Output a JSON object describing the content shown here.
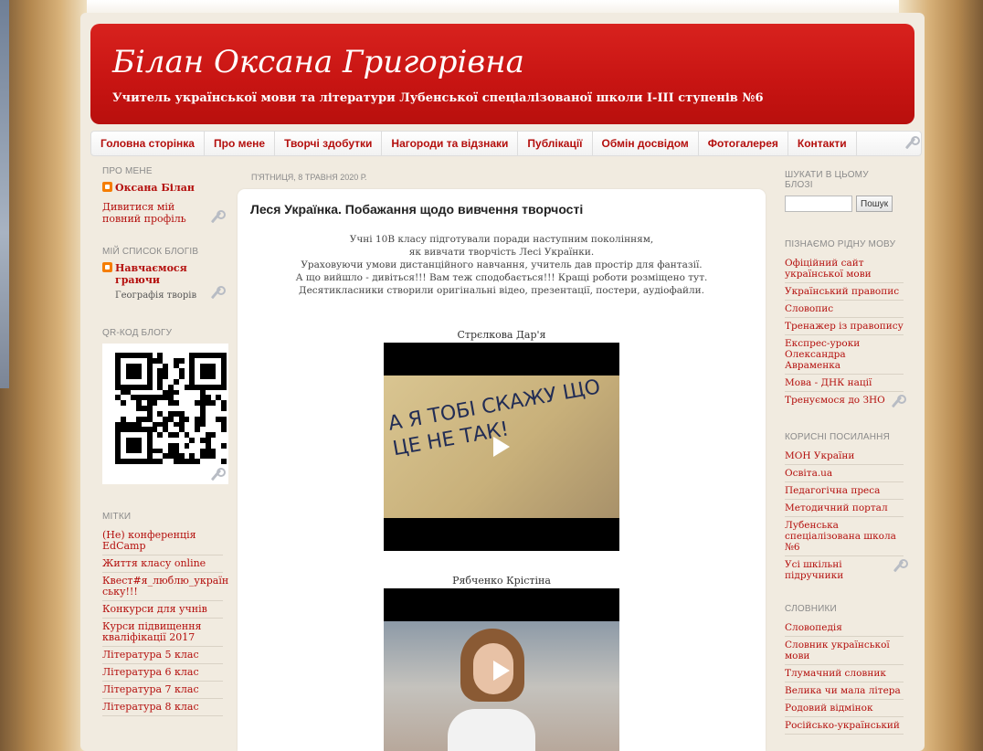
{
  "blog": {
    "title": "Білан Оксана Григорівна",
    "subtitle": "Учитель української мови та літератури Лубенської спеціалізованої школи І-ІІІ ступенів №6"
  },
  "nav": {
    "tabs": [
      "Головна сторінка",
      "Про мене",
      "Творчі здобутки",
      "Нагороди та відзнаки",
      "Публікації",
      "Обмін досвідом",
      "Фотогалерея",
      "Контакти"
    ]
  },
  "left_sidebar": {
    "about": {
      "heading": "ПРО МЕНЕ",
      "name": "Оксана Білан",
      "profile_link": "Дивитися мій повний профіль"
    },
    "blog_list": {
      "heading": "МІЙ СПИСОК БЛОГІВ",
      "blog_name": "Навчаємося граючи",
      "post_title": "Географія творів"
    },
    "qr": {
      "heading": "QR-КОД БЛОГУ"
    },
    "labels": {
      "heading": "МІТКИ",
      "items": [
        "(Не) конференція EdCamp",
        "Життя класу online",
        "Квест#я_люблю_україн ську!!!",
        "Конкурси для учнів",
        "Курси підвищення кваліфікації 2017",
        "Література 5 клас",
        "Література 6 клас",
        "Література 7 клас",
        "Література 8 клас"
      ]
    }
  },
  "post": {
    "date": "П'ЯТНИЦЯ, 8 ТРАВНЯ 2020 Р.",
    "title": "Леся Українка. Побажання щодо вивчення творчості",
    "body_lines": [
      "Учні 10В класу підготували поради наступним поколінням,",
      "як вивчати творчість Лесі Українки.",
      "Ураховуючи умови дистанційного навчання, учитель дав простір для фантазії.",
      "А що вийшло - дивіться!!! Вам теж сподобається!!! Кращі роботи розміщено тут.",
      "Десятикласники створили оригінальні відео, презентації, постери, аудіофайли."
    ],
    "videos": [
      {
        "caption": "Стрєлкова Дар'я",
        "frame_text": "А Я ТОБІ СКАЖУ ЩО ЦЕ НЕ ТАК!"
      },
      {
        "caption": "Рябченко Крістіна"
      }
    ]
  },
  "right_sidebar": {
    "search": {
      "heading": "ШУКАТИ В ЦЬОМУ БЛОЗІ",
      "button": "Пошук"
    },
    "language": {
      "heading": "ПІЗНАЄМО РІДНУ МОВУ",
      "items": [
        "Офіційний сайт української мови",
        "Український правопис",
        "Словопис",
        "Тренажер із правопису",
        "Експрес-уроки Олександра Авраменка",
        "Мова - ДНК нації",
        "Тренуємося до ЗНО"
      ]
    },
    "useful": {
      "heading": "КОРИСНІ ПОСИЛАННЯ",
      "items": [
        "МОН України",
        "Освіта.ua",
        "Педагогічна преса",
        "Методичний портал",
        "Лубенська спеціалізована школа №6",
        "Усі шкільні підручники"
      ]
    },
    "dictionaries": {
      "heading": "СЛОВНИКИ",
      "items": [
        "Словопедія",
        "Словник української мови",
        "Тлумачний словник",
        "Велика чи мала літера",
        "Родовий відмінок",
        "Російсько-український"
      ]
    }
  },
  "colors": {
    "header_red": "#c71412",
    "link_red": "#b40f0d",
    "muted_grey": "#8a8a8a"
  }
}
